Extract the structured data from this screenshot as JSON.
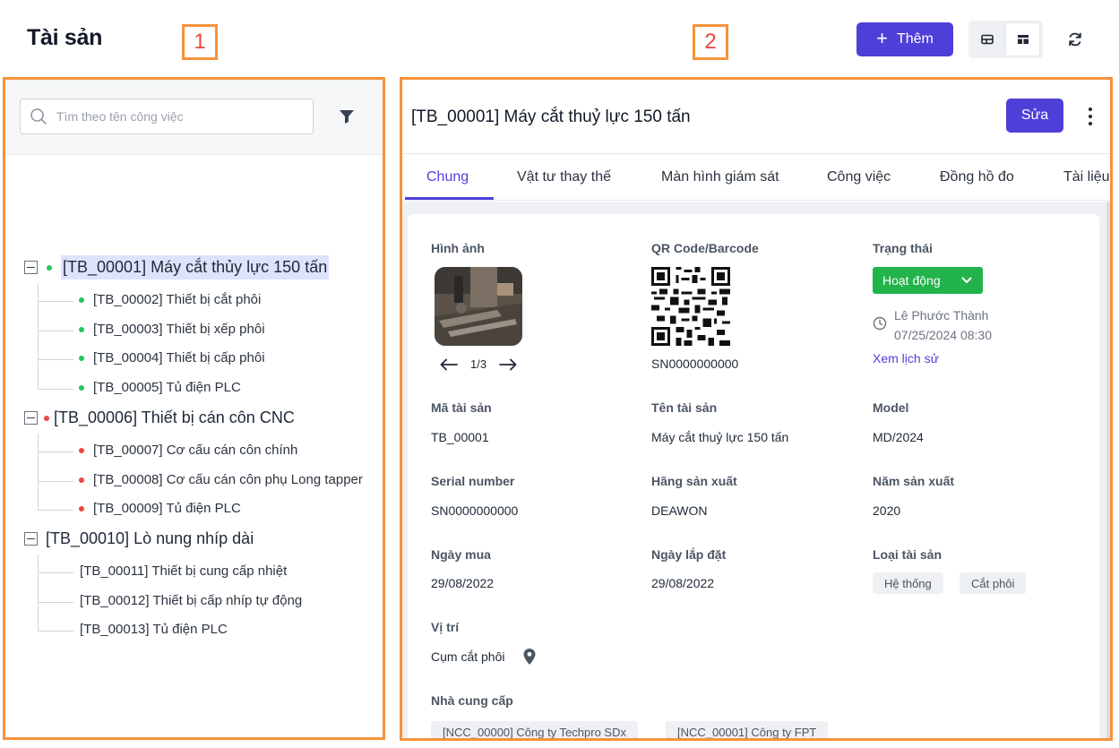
{
  "header": {
    "title": "Tài sản",
    "callout_1": "1",
    "callout_2": "2",
    "add_label": "Thêm"
  },
  "colors": {
    "primary": "#4f3fd9",
    "success": "#22b34b",
    "callout": "#f7923a"
  },
  "sidebar": {
    "search_placeholder": "Tìm theo tên công việc",
    "tree": [
      {
        "label": "[TB_00001] Máy cắt thủy lực 150 tấn",
        "status": "green",
        "selected": true,
        "children": [
          {
            "label": "[TB_00002] Thiết bị cắt phôi",
            "status": "green"
          },
          {
            "label": "[TB_00003] Thiết bị xếp phôi",
            "status": "green"
          },
          {
            "label": "[TB_00004] Thiết bị cấp phôi",
            "status": "green"
          },
          {
            "label": "[TB_00005] Tủ điện PLC",
            "status": "green"
          }
        ]
      },
      {
        "label": "[TB_00006] Thiết bị cán côn CNC",
        "status": "red",
        "children": [
          {
            "label": "[TB_00007] Cơ cấu cán côn chính",
            "status": "red"
          },
          {
            "label": "[TB_00008] Cơ cấu cán côn phụ Long tapper",
            "status": "red"
          },
          {
            "label": "[TB_00009] Tủ điện PLC",
            "status": "red"
          }
        ]
      },
      {
        "label": "[TB_00010] Lò nung nhíp dài",
        "status": "none",
        "children": [
          {
            "label": "[TB_00011] Thiết bị cung cấp nhiệt",
            "status": "none"
          },
          {
            "label": "[TB_00012] Thiết bị cấp nhíp tự động",
            "status": "none"
          },
          {
            "label": "[TB_00013] Tủ điện PLC",
            "status": "none"
          }
        ]
      }
    ]
  },
  "detail": {
    "title": "[TB_00001] Máy cắt thuỷ lực 150 tấn",
    "edit_label": "Sửa",
    "tabs": [
      "Chung",
      "Vật tư thay thế",
      "Màn hình giám sát",
      "Công việc",
      "Đồng hồ đo",
      "Tài liệu đ"
    ],
    "image_label": "Hình ảnh",
    "image_pager": "1/3",
    "qr_label": "QR Code/Barcode",
    "qr_value": "SN0000000000",
    "status_label": "Trạng thái",
    "status_value": "Hoạt động",
    "history_user": "Lê Phước Thành",
    "history_time": "07/25/2024 08:30",
    "history_link": "Xem lịch sử",
    "fields": {
      "asset_code_label": "Mã tài sản",
      "asset_code": "TB_00001",
      "asset_name_label": "Tên tài sản",
      "asset_name": "Máy cắt thuỷ lực 150 tấn",
      "model_label": "Model",
      "model": "MD/2024",
      "serial_label": "Serial number",
      "serial": "SN0000000000",
      "maker_label": "Hãng sản xuất",
      "maker": "DEAWON",
      "year_label": "Năm sản xuất",
      "year": "2020",
      "purchase_label": "Ngày mua",
      "purchase": "29/08/2022",
      "install_label": "Ngày lắp đặt",
      "install": "29/08/2022",
      "type_label": "Loại tài sản",
      "types": [
        "Hệ thống",
        "Cắt phôi"
      ],
      "location_label": "Vị trí",
      "location": "Cụm cắt phôi",
      "supplier_label": "Nhà cung cấp",
      "suppliers": [
        "[NCC_00000] Công ty Techpro SDx",
        "[NCC_00001] Công ty FPT"
      ]
    }
  }
}
